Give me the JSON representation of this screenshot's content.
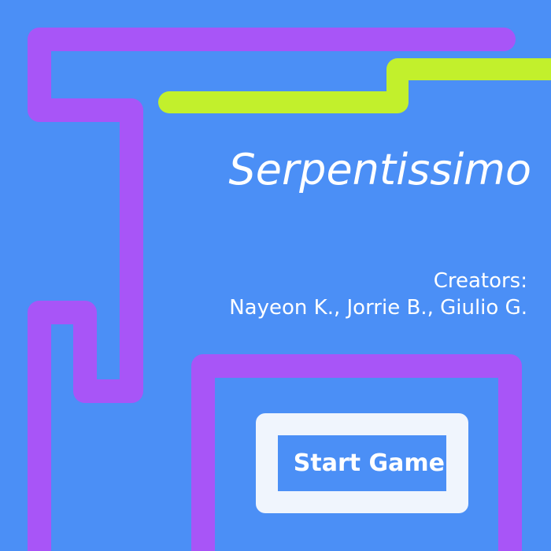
{
  "game": {
    "title": "Serpentissimo",
    "creators_label": "Creators:",
    "creators_names": "Nayeon K., Jorrie B., Giulio G."
  },
  "start_button": {
    "label": "Start Game"
  },
  "colors": {
    "background": "#4b8ff6",
    "purple_snake": "#a855f7",
    "green_snake": "#c2f02c",
    "button_border": "#f0f5fd",
    "text": "#ffffff"
  }
}
